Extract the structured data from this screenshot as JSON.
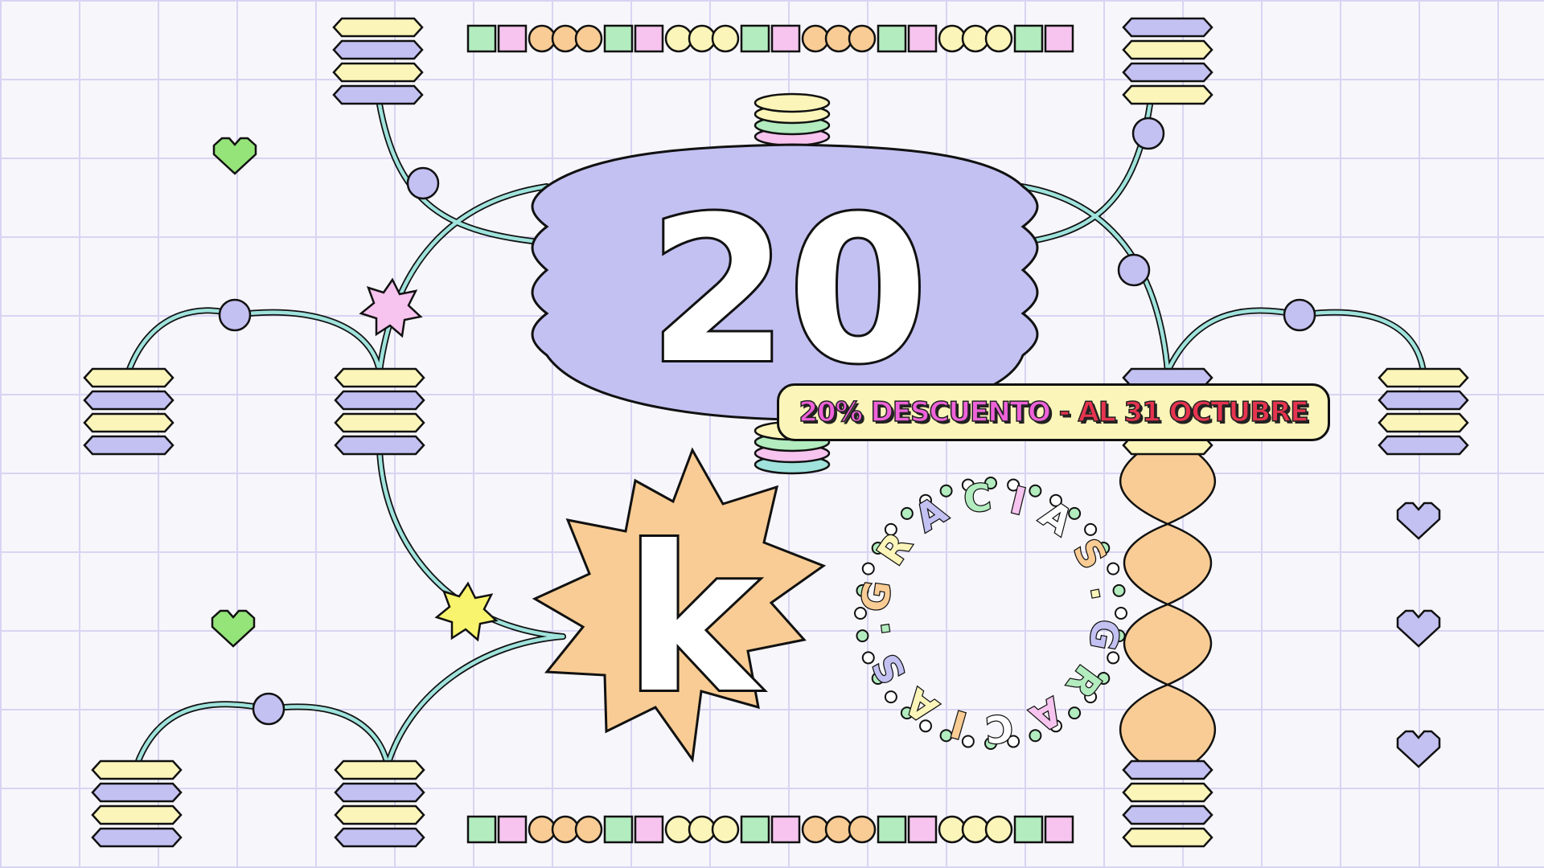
{
  "headline": {
    "number": "20",
    "unit": "k"
  },
  "banner": {
    "discount": "20% DESCUENTO",
    "separator": " - ",
    "deadline": "AL 31 OCTUBRE"
  },
  "badge": {
    "text": "GRACIAS.GRACIAS."
  },
  "palette": {
    "lavender": "#c3c1f2",
    "yellow": "#fbf5b9",
    "peach": "#f8cc94",
    "green": "#b2ecbf",
    "pink": "#f6c4ee",
    "teal": "#9fe3dc",
    "heart_green": "#94e479",
    "heart_lavender": "#c3c1f2",
    "star_pink": "#f6c4ee",
    "star_yellow": "#f8f46e",
    "outline": "#111111"
  },
  "icons": [
    "heart-icon",
    "star-icon",
    "gear-badge-icon",
    "coin-stack-icon",
    "bead-string-icon"
  ]
}
